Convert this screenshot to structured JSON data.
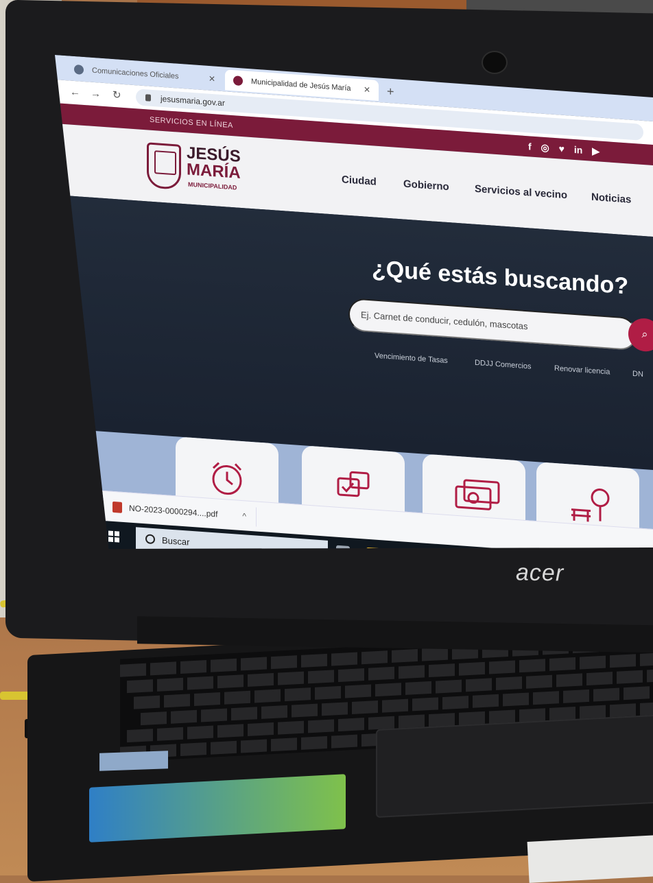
{
  "browser": {
    "tabs": [
      {
        "label": "Comunicaciones Oficiales",
        "active": false
      },
      {
        "label": "Municipalidad de Jesús María",
        "active": true
      }
    ],
    "url": "jesusmaria.gov.ar"
  },
  "site": {
    "top_strip": "SERVICIOS EN LÍNEA",
    "social_icons": [
      "facebook-icon",
      "instagram-icon",
      "twitter-icon",
      "linkedin-icon",
      "youtube-icon"
    ],
    "social_glyphs": "f ◎ ♥ in ▶",
    "brand": {
      "line1": "JESÚS",
      "line2": "MARÍA",
      "line3": "MUNICIPALIDAD"
    },
    "menu": [
      "Ciudad",
      "Gobierno",
      "Servicios al vecino",
      "Noticias"
    ],
    "hero": {
      "headline": "¿Qué estás buscando?",
      "search_placeholder": "Ej. Carnet de conducir, cedulón, mascotas",
      "quick_links": [
        "Vencimiento de Tasas",
        "DDJJ Comercios",
        "Renovar licencia",
        "DN"
      ]
    },
    "cards": [
      "alarm-clock-icon",
      "chat-check-icon",
      "money-icon",
      "park-bench-tree-icon"
    ],
    "colors": {
      "brand": "#7b1b3a",
      "accent": "#b01d45",
      "hero": "#1d2634"
    }
  },
  "downloads": {
    "file": "NO-2023-0000294....pdf"
  },
  "taskbar": {
    "search": "Buscar"
  },
  "laptop": {
    "logo": "acer"
  }
}
